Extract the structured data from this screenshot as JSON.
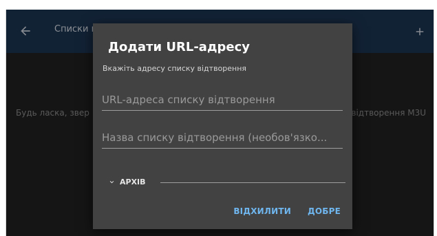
{
  "appbar": {
    "title": "Списки в",
    "back_icon": "arrow-left-icon",
    "add_icon": "plus-icon"
  },
  "background": {
    "message_left": "Будь ласка, звер",
    "message_right": "відтворення M3U"
  },
  "dialog": {
    "title": "Додати URL-адресу",
    "hint": "Вкажіть адресу списку відтворення",
    "url_field": {
      "placeholder": "URL-адреса списку відтворення",
      "value": ""
    },
    "name_field": {
      "placeholder": "Назва списку відтворення (необов'язко...",
      "value": ""
    },
    "archive_label": "АРХІВ",
    "archive_icon": "chevron-down-icon",
    "cancel_label": "ВІДХИЛИТИ",
    "ok_label": "ДОБРЕ"
  },
  "colors": {
    "appbar": "#1d3552",
    "background": "#212121",
    "dialog": "#424242",
    "accent": "#6fb6ef"
  }
}
